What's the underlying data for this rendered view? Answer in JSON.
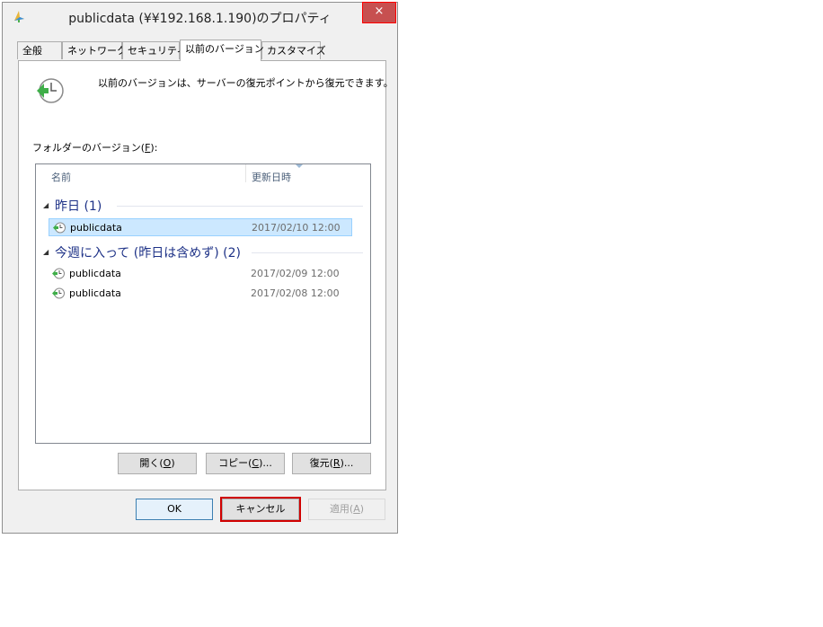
{
  "window": {
    "title": "publicdata (¥¥192.168.1.190)のプロパティ",
    "close_glyph": "×",
    "title_icon": "folder-network-icon"
  },
  "tabs": [
    {
      "label": "全般"
    },
    {
      "label": "ネットワーク"
    },
    {
      "label": "セキュリティ"
    },
    {
      "label": "以前のバージョン",
      "active": true
    },
    {
      "label": "カスタマイズ"
    }
  ],
  "panel": {
    "description": "以前のバージョンは、サーバーの復元ポイントから復元できます。",
    "icon": "restore-clock-icon",
    "folder_versions_label": "フォルダーのバージョン(",
    "folder_versions_key": "F",
    "folder_versions_suffix": "):"
  },
  "list": {
    "columns": {
      "name": "名前",
      "modified": "更新日時"
    },
    "groups": [
      {
        "title": "昨日 (1)",
        "items": [
          {
            "name": "publicdata",
            "date": "2017/02/10 12:00",
            "selected": true
          }
        ]
      },
      {
        "title": "今週に入って (昨日は含めず) (2)",
        "items": [
          {
            "name": "publicdata",
            "date": "2017/02/09 12:00"
          },
          {
            "name": "publicdata",
            "date": "2017/02/08 12:00"
          }
        ]
      }
    ]
  },
  "panel_buttons": {
    "open": {
      "pre": "開く(",
      "key": "O",
      "post": ")"
    },
    "copy": {
      "pre": "コピー(",
      "key": "C",
      "post": ")..."
    },
    "restore": {
      "pre": "復元(",
      "key": "R",
      "post": ")..."
    }
  },
  "footer": {
    "ok": "OK",
    "cancel": "キャンセル",
    "apply": {
      "pre": "適用(",
      "key": "A",
      "post": ")",
      "disabled": true
    }
  },
  "colors": {
    "group_title": "#1e3287",
    "selection": "#cce8ff",
    "highlight_box": "#d00000"
  }
}
